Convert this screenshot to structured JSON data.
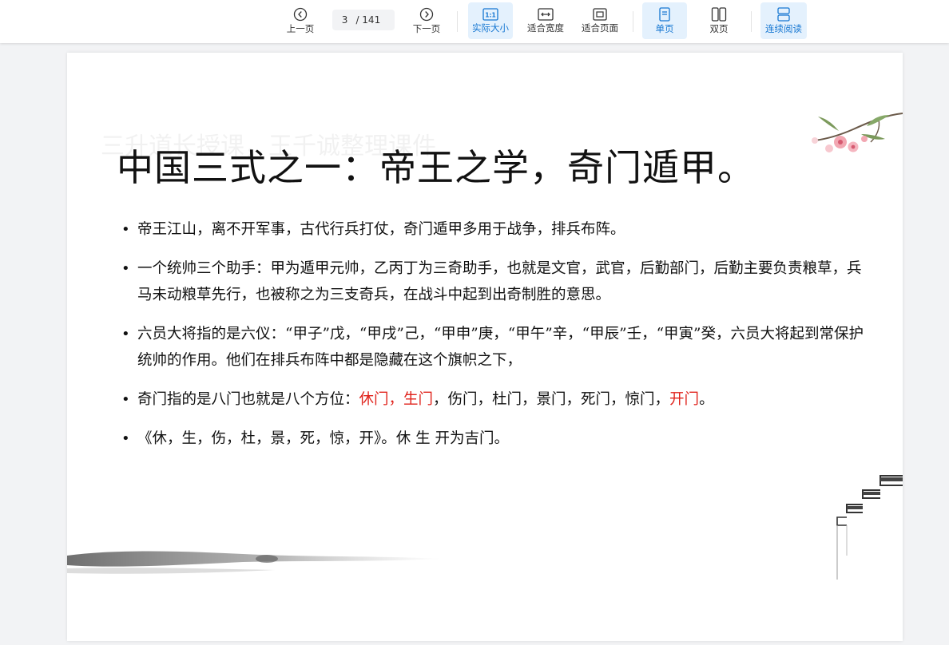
{
  "toolbar": {
    "prev_label": "上一页",
    "page_current": "3",
    "page_total": "/ 141",
    "next_label": "下一页",
    "actual_size_label": "实际大小",
    "actual_size_icon_text": "1:1",
    "fit_width_label": "适合宽度",
    "fit_page_label": "适合页面",
    "single_label": "单页",
    "double_label": "双页",
    "continuous_label": "连续阅读"
  },
  "slide": {
    "watermark": "三升道长授课，王千诚整理课件",
    "title": "中国三式之一：帝王之学，奇门遁甲。",
    "bullets": [
      "帝王江山，离不开军事，古代行兵打仗，奇门遁甲多用于战争，排兵布阵。",
      "一个统帅三个助手：甲为遁甲元帅，乙丙丁为三奇助手，也就是文官，武官，后勤部门，后勤主要负责粮草，兵马未动粮草先行，也被称之为三支奇兵，在战斗中起到出奇制胜的意思。",
      "六员大将指的是六仪：“甲子”戊，“甲戌”己，“甲申”庚，“甲午”辛，“甲辰”壬，“甲寅”癸，六员大将起到常保护统帅的作用。他们在排兵布阵中都是隐藏在这个旗帜之下，"
    ],
    "bullet4": {
      "prefix": "奇门指的是八门也就是八个方位：",
      "red1": "休门，生门",
      "middle": "，伤门，杜门，景门，死门，惊门，",
      "red2": "开门",
      "suffix": "。"
    },
    "bullet5": "《休，生，伤，杜，景，死，惊，开》。休 生 开为吉门。"
  },
  "colors": {
    "accent": "#1677d2",
    "active_bg": "#e4f1fd",
    "highlight_red": "#e0231c"
  }
}
